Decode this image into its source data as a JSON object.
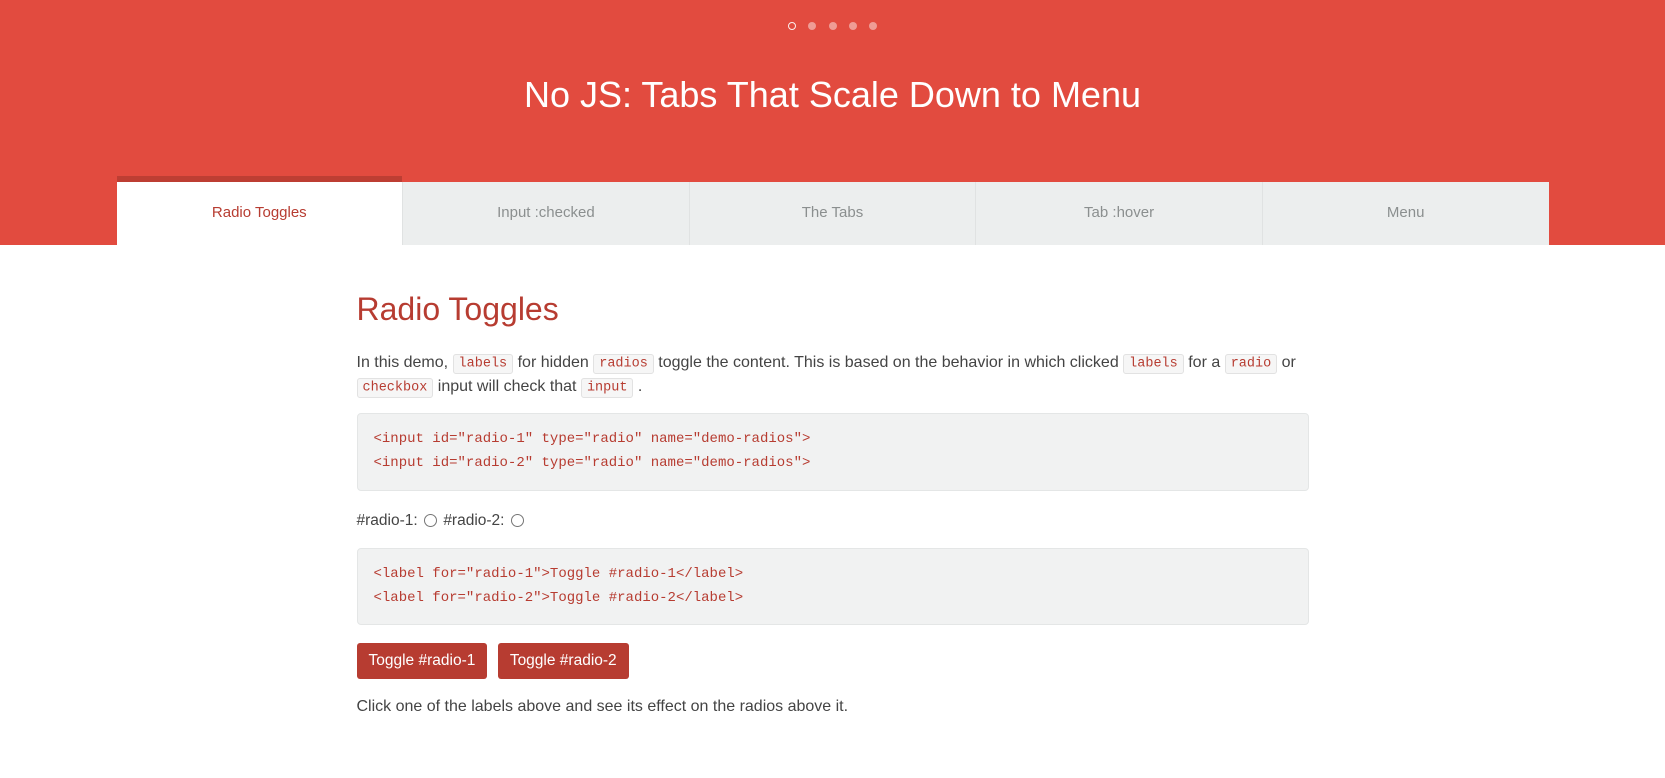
{
  "header": {
    "title": "No JS: Tabs That Scale Down to Menu",
    "dots_count": 5,
    "active_dot_index": 0
  },
  "tabs": [
    {
      "label": "Radio Toggles",
      "active": true
    },
    {
      "label": "Input :checked",
      "active": false
    },
    {
      "label": "The Tabs",
      "active": false
    },
    {
      "label": "Tab :hover",
      "active": false
    },
    {
      "label": "Menu",
      "active": false
    }
  ],
  "content": {
    "heading": "Radio Toggles",
    "intro": {
      "t1": "In this demo, ",
      "c1": "labels",
      "t2": " for hidden ",
      "c2": "radios",
      "t3": " toggle the content. This is based on the behavior in which clicked ",
      "c3": "labels",
      "t4": " for a ",
      "c4": "radio",
      "t5": " or ",
      "c5": "checkbox",
      "t6": " input will check that ",
      "c6": "input",
      "t7": "."
    },
    "code1": "<input id=\"radio-1\" type=\"radio\" name=\"demo-radios\">\n<input id=\"radio-2\" type=\"radio\" name=\"demo-radios\">",
    "radios": {
      "label1": "#radio-1:",
      "label2": "#radio-2:"
    },
    "code2": "<label for=\"radio-1\">Toggle #radio-1</label>\n<label for=\"radio-2\">Toggle #radio-2</label>",
    "buttons": {
      "b1": "Toggle #radio-1",
      "b2": "Toggle #radio-2"
    },
    "outro": "Click one of the labels above and see its effect on the radios above it."
  }
}
